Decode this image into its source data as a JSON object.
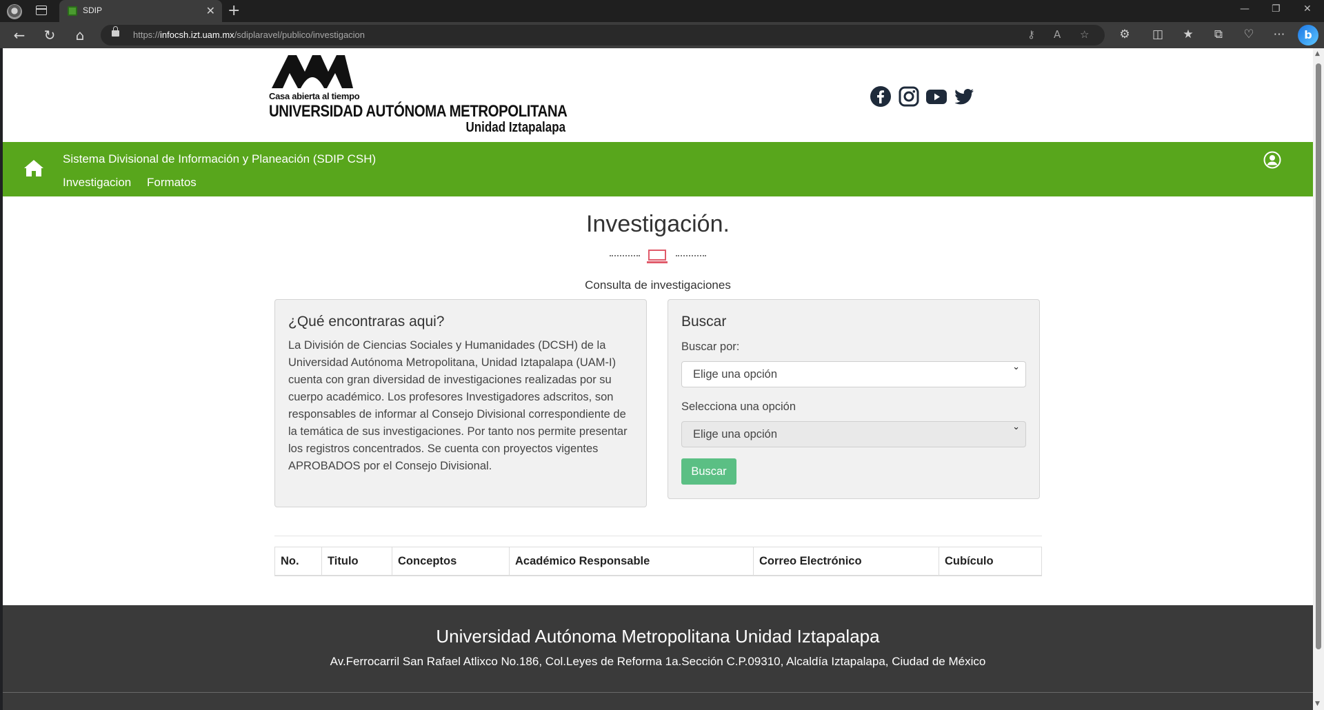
{
  "browser": {
    "tab_title": "SDIP",
    "tab_close": "✕",
    "new_tab": "+",
    "url_prefix": "https://",
    "url_host": "infocsh.izt.uam.mx",
    "url_path": "/sdiplaravel/publico/investigacion",
    "window_controls": [
      "—",
      "❐",
      "✕"
    ]
  },
  "header": {
    "logo_tagline": "Casa abierta al tiempo",
    "logo_name": "UNIVERSIDAD AUTÓNOMA METROPOLITANA",
    "logo_unit": "Unidad Iztapalapa",
    "social_icons": [
      "facebook-icon",
      "instagram-icon",
      "youtube-icon",
      "twitter-icon"
    ]
  },
  "navbar": {
    "title": "Sistema Divisional de Información y Planeación (SDIP CSH)",
    "links": [
      "Investigacion",
      "Formatos"
    ],
    "color": "#58a61c"
  },
  "main": {
    "title": "Investigación.",
    "subtitle": "Consulta de investigaciones",
    "info_card": {
      "title": "¿Qué encontraras aqui?",
      "text": "La División de Ciencias Sociales y Humanidades (DCSH) de la Universidad Autónoma Metropolitana, Unidad Iztapalapa (UAM-I) cuenta con gran diversidad de investigaciones realizadas por su cuerpo académico. Los profesores Investigadores adscritos, son responsables de informar al Consejo Divisional correspondiente de la temática de sus investigaciones. Por tanto nos permite presentar los registros concentrados. Se cuenta con proyectos vigentes APROBADOS por el Consejo Divisional."
    },
    "search_card": {
      "title": "Buscar",
      "label_1": "Buscar por:",
      "select_1_value": "Elige una opción",
      "label_2": "Selecciona una opción",
      "select_2_value": "Elige una opción",
      "button": "Buscar",
      "button_color": "#5bbf84"
    },
    "table": {
      "headers": [
        "No.",
        "Titulo",
        "Conceptos",
        "Académico Responsable",
        "Correo Electrónico",
        "Cubículo"
      ]
    }
  },
  "footer": {
    "title": "Universidad Autónoma Metropolitana Unidad Iztapalapa",
    "address": "Av.Ferrocarril San Rafael Atlixco No.186, Col.Leyes de Reforma 1a.Sección C.P.09310, Alcaldía Iztapalapa, Ciudad de México"
  }
}
